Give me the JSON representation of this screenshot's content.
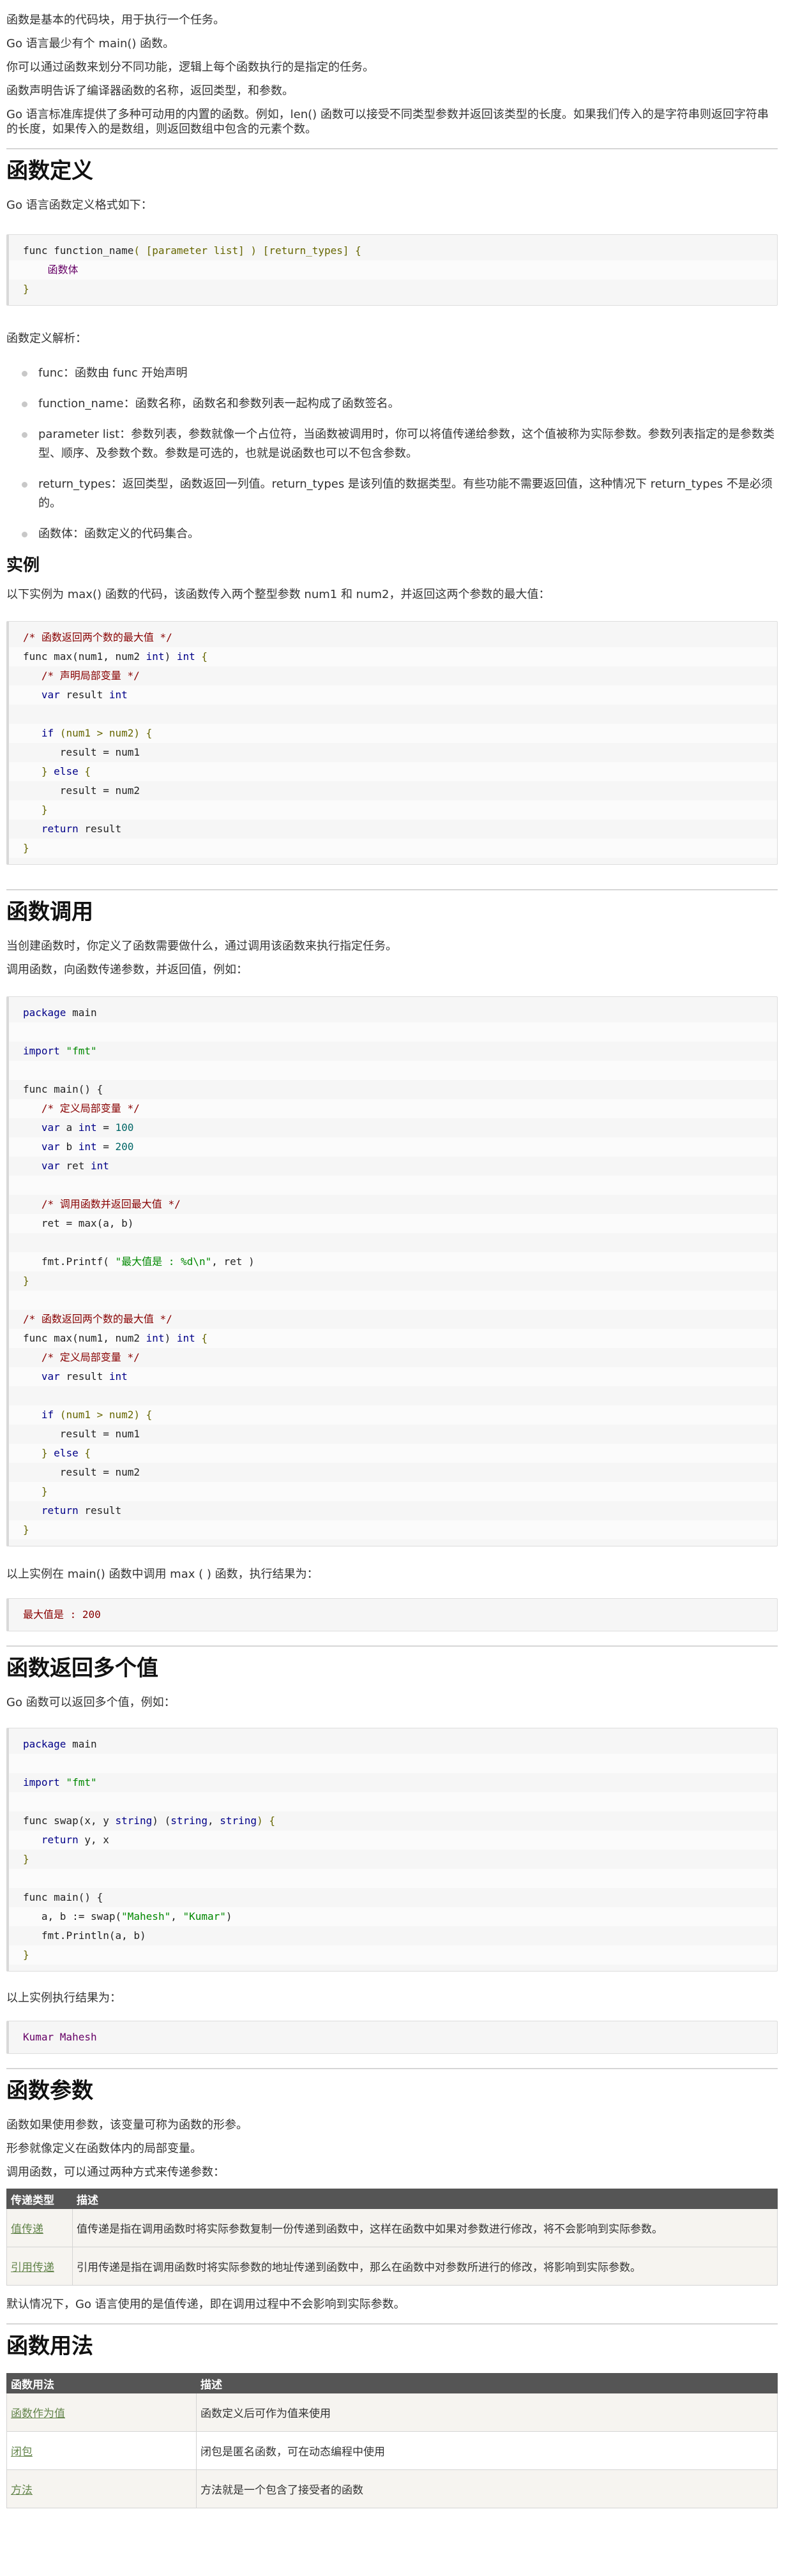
{
  "intro": [
    "函数是基本的代码块，用于执行一个任务。",
    "Go 语言最少有个 main() 函数。",
    "你可以通过函数来划分不同功能，逻辑上每个函数执行的是指定的任务。",
    "函数声明告诉了编译器函数的名称，返回类型，和参数。",
    "Go 语言标准库提供了多种可动用的内置的函数。例如，len() 函数可以接受不同类型参数并返回该类型的长度。如果我们传入的是字符串则返回字符串的长度，如果传入的是数组，则返回数组中包含的元素个数。"
  ],
  "def": {
    "heading": "函数定义",
    "desc": "Go 语言函数定义格式如下：",
    "code": {
      "l1": [
        "func function_name",
        "( [parameter list] ) [return_types] {"
      ],
      "l2": "函数体",
      "l3": "}"
    },
    "parse_label": "函数定义解析：",
    "items": [
      "func：函数由 func 开始声明",
      "function_name：函数名称，函数名和参数列表一起构成了函数签名。",
      "parameter list：参数列表，参数就像一个占位符，当函数被调用时，你可以将值传递给参数，这个值被称为实际参数。参数列表指定的是参数类型、顺序、及参数个数。参数是可选的，也就是说函数也可以不包含参数。",
      "return_types：返回类型，函数返回一列值。return_types 是该列值的数据类型。有些功能不需要返回值，这种情况下 return_types 不是必须的。",
      "函数体：函数定义的代码集合。"
    ]
  },
  "example": {
    "heading": "实例",
    "desc": "以下实例为 max() 函数的代码，该函数传入两个整型参数 num1 和 num2，并返回这两个参数的最大值：",
    "code": {
      "c1": "/* 函数返回两个数的最大值 */",
      "l2a": "func max(num1, num2 ",
      "l2b": "int",
      "l2c": ") ",
      "l2d": "int",
      "l2e": " {",
      "c3": "/* 声明局部变量 */",
      "l4a": "var",
      "l4b": " result ",
      "l4c": "int",
      "l6a": "if",
      "l6b": " (num1 > num2) {",
      "l7": "result = num1",
      "l8a": "} ",
      "l8b": "else",
      "l8c": " {",
      "l9": "result = num2",
      "l10": "}",
      "l11a": "return",
      "l11b": " result",
      "l12": "}"
    }
  },
  "call": {
    "heading": "函数调用",
    "p1": "当创建函数时，你定义了函数需要做什么，通过调用该函数来执行指定任务。",
    "p2": "调用函数，向函数传递参数，并返回值，例如：",
    "code": {
      "a1": "package",
      "a2": " main",
      "b1": "import",
      "b2": " \"fmt\"",
      "c1": "func main() {",
      "d1": "/* 定义局部变量 */",
      "e1": "var",
      "e2": " a ",
      "e3": "int",
      "e4": " = ",
      "e5": "100",
      "f1": "var",
      "f2": " b ",
      "f3": "int",
      "f4": " = ",
      "f5": "200",
      "g1": "var",
      "g2": " ret ",
      "g3": "int",
      "h1": "/* 调用函数并返回最大值 */",
      "i1": "ret = max(a, b)",
      "j1": "fmt.Printf(",
      "j2": " \"最大值是 : %d\\n\"",
      "j3": ", ret )",
      "k1": "}",
      "m1": "/* 函数返回两个数的最大值 */",
      "n1": "func max(num1, num2 ",
      "n2": "int",
      "n3": ") ",
      "n4": "int",
      "n5": " {",
      "o1": "/* 定义局部变量 */",
      "p1a": "var",
      "p1b": " result ",
      "p1c": "int",
      "q1": "if",
      "q2": " (num1 > num2) {",
      "r1": "result = num1",
      "s1": "} ",
      "s2": "else",
      "s3": " {",
      "t1": "result = num2",
      "u1": "}",
      "v1": "return",
      "v2": " result",
      "w1": "}"
    },
    "result_desc": "以上实例在 main() 函数中调用 max ( ) 函数，执行结果为：",
    "output": "最大值是 : 200"
  },
  "multi": {
    "heading": "函数返回多个值",
    "desc": "Go 函数可以返回多个值，例如：",
    "code": {
      "a1": "package",
      "a2": " main",
      "b1": "import",
      "b2": " \"fmt\"",
      "c1": "func swap(x, y ",
      "c2": "string",
      "c3": ") (",
      "c4": "string",
      "c5": ", ",
      "c6": "string",
      "c7": ") {",
      "d1": "return",
      "d2": " y, x",
      "e1": "}",
      "f1": "func main() {",
      "g1": "a, b := swap(",
      "g2": "\"Mahesh\"",
      "g3": ", ",
      "g4": "\"Kumar\"",
      "g5": ")",
      "h1": "fmt.Println(a, b)",
      "i1": "}"
    },
    "result_desc": "以上实例执行结果为：",
    "output": "Kumar Mahesh"
  },
  "params": {
    "heading": "函数参数",
    "p1": "函数如果使用参数，该变量可称为函数的形参。",
    "p2": "形参就像定义在函数体内的局部变量。",
    "p3": "调用函数，可以通过两种方式来传递参数：",
    "table": {
      "headers": [
        "传递类型",
        "描述"
      ],
      "rows": [
        [
          "值传递",
          "值传递是指在调用函数时将实际参数复制一份传递到函数中，这样在函数中如果对参数进行修改，将不会影响到实际参数。"
        ],
        [
          "引用传递",
          "引用传递是指在调用函数时将实际参数的地址传递到函数中，那么在函数中对参数所进行的修改，将影响到实际参数。"
        ]
      ]
    },
    "note": "默认情况下，Go 语言使用的是值传递，即在调用过程中不会影响到实际参数。"
  },
  "usage": {
    "heading": "函数用法",
    "table": {
      "headers": [
        "函数用法",
        "描述"
      ],
      "rows": [
        [
          "函数作为值",
          "函数定义后可作为值来使用"
        ],
        [
          "闭包",
          "闭包是匿名函数，可在动态编程中使用"
        ],
        [
          "方法",
          "方法就是一个包含了接受者的函数"
        ]
      ]
    }
  }
}
